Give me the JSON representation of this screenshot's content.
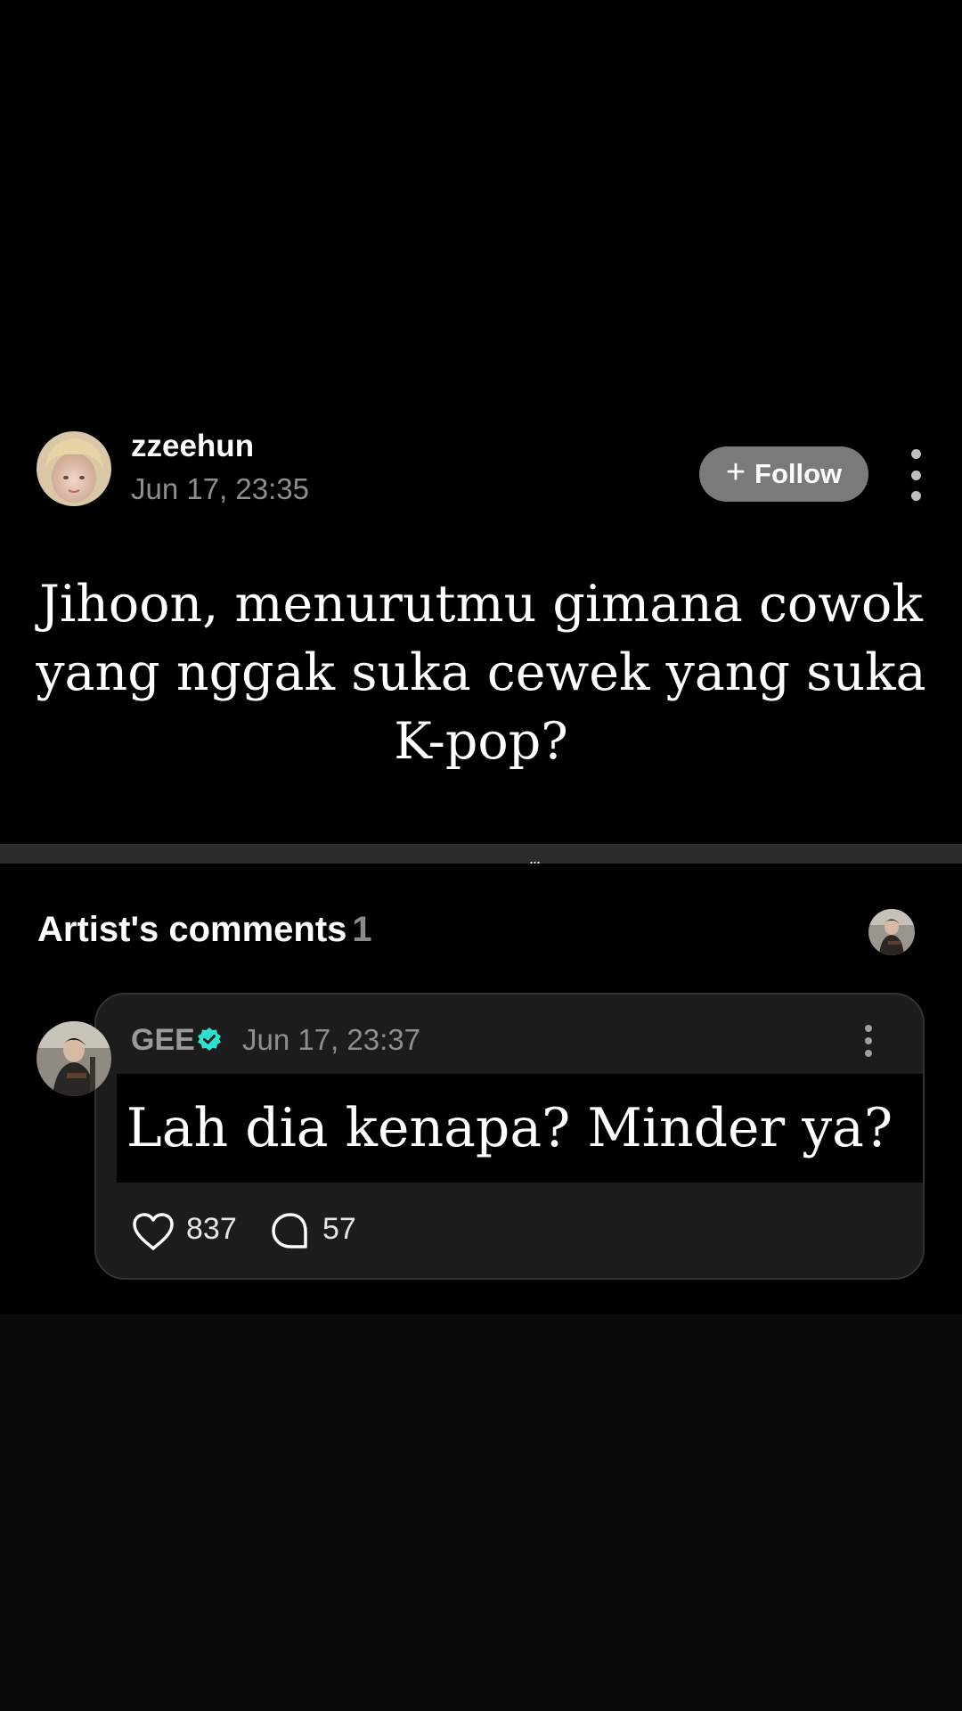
{
  "post": {
    "username": "zzeehun",
    "timestamp": "Jun 17, 23:35",
    "follow_label": "Follow",
    "follow_icon": "plus-icon",
    "question": "Jihoon, menurutmu gimana cowok yang nggak suka cewek yang suka K-pop?"
  },
  "divider": {
    "ellipsis": "..."
  },
  "artist_comments": {
    "title": "Artist's comments",
    "count": "1"
  },
  "comment": {
    "author": "GEE",
    "verified_icon": "verified-badge-icon",
    "verified_color": "#2ee0d0",
    "timestamp": "Jun 17, 23:37",
    "text": "Lah dia kenapa? Minder ya?",
    "likes": "837",
    "replies": "57"
  }
}
